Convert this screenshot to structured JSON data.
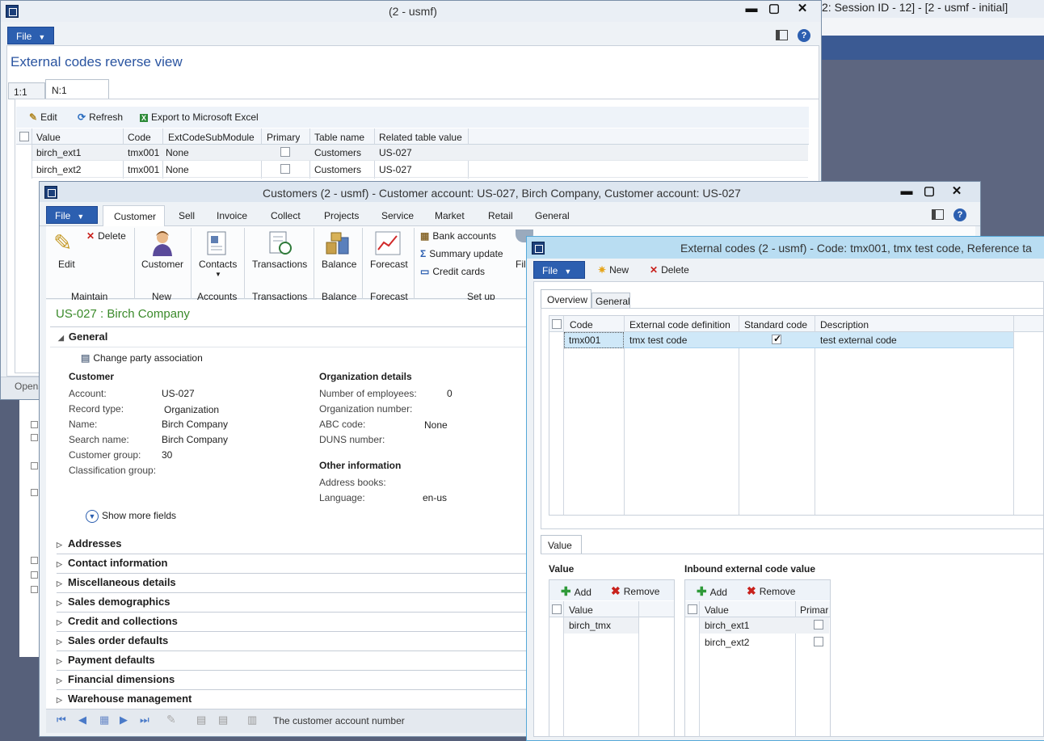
{
  "bg_window": {
    "title": "2: Session ID - 12] -  [2 - usmf - initial]"
  },
  "reverse_view": {
    "title": "(2 - usmf)",
    "file_label": "File",
    "heading": "External codes reverse view",
    "tabs": [
      "1:1",
      "N:1"
    ],
    "toolbar": {
      "edit": "Edit",
      "refresh": "Refresh",
      "export": "Export to Microsoft Excel"
    },
    "columns": [
      "Value",
      "Code",
      "ExtCodeSubModule",
      "Primary",
      "Table name",
      "Related table value"
    ],
    "rows": [
      {
        "value": "birch_ext1",
        "code": "tmx001",
        "submodule": "None",
        "table": "Customers",
        "related": "US-027"
      },
      {
        "value": "birch_ext2",
        "code": "tmx001",
        "submodule": "None",
        "table": "Customers",
        "related": "US-027"
      }
    ],
    "status": "Opens"
  },
  "customers": {
    "title": "Customers (2 - usmf) - Customer account: US-027, Birch Company, Customer account: US-027",
    "file_label": "File",
    "tabs": [
      "Customer",
      "Sell",
      "Invoice",
      "Collect",
      "Projects",
      "Service",
      "Market",
      "Retail",
      "General"
    ],
    "ribbon": {
      "edit": "Edit",
      "delete": "Delete",
      "maintain": "Maintain",
      "customer": "Customer",
      "new": "New",
      "contacts": "Contacts",
      "accounts": "Accounts",
      "transactions": "Transactions",
      "transactions_grp": "Transactions",
      "balance": "Balance",
      "balance_grp": "Balance",
      "forecast": "Forecast",
      "forecast_grp": "Forecast",
      "bank_accounts": "Bank accounts",
      "summary_update": "Summary update",
      "credit_cards": "Credit cards",
      "setup": "Set up",
      "filter_partial": "Fil"
    },
    "record_title": "US-027 : Birch Company",
    "general_label": "General",
    "change_party": "Change party association",
    "customer_section": "Customer",
    "org_section": "Organization details",
    "other_section": "Other information",
    "fields": {
      "account_lbl": "Account:",
      "account": "US-027",
      "record_type_lbl": "Record type:",
      "record_type": "Organization",
      "name_lbl": "Name:",
      "name": "Birch Company",
      "search_name_lbl": "Search name:",
      "search_name": "Birch Company",
      "cust_group_lbl": "Customer group:",
      "cust_group": "30",
      "class_group_lbl": "Classification group:",
      "employees_lbl": "Number of employees:",
      "employees": "0",
      "org_number_lbl": "Organization number:",
      "abc_lbl": "ABC code:",
      "abc": "None",
      "duns_lbl": "DUNS number:",
      "address_books_lbl": "Address books:",
      "language_lbl": "Language:",
      "language": "en-us"
    },
    "show_more": "Show more fields",
    "fasttabs": [
      "Addresses",
      "Contact information",
      "Miscellaneous details",
      "Sales demographics",
      "Credit and collections",
      "Sales order defaults",
      "Payment defaults",
      "Financial dimensions",
      "Warehouse management"
    ],
    "status_text": "The customer account number"
  },
  "ext_codes": {
    "title": "External codes (2 - usmf) - Code: tmx001, tmx test code, Reference ta",
    "file_label": "File",
    "new": "New",
    "delete": "Delete",
    "tabs": [
      "Overview",
      "General"
    ],
    "columns": [
      "Code",
      "External code definition",
      "Standard code",
      "Description"
    ],
    "rows": [
      {
        "code": "tmx001",
        "definition": "tmx test code",
        "standard": true,
        "description": "test external code"
      }
    ],
    "value_tab": "Value",
    "value_section": "Value",
    "inbound_section": "Inbound external code value",
    "add": "Add",
    "remove": "Remove",
    "value_col": "Value",
    "primary_col": "Primar",
    "values": [
      "birch_tmx"
    ],
    "inbound": [
      "birch_ext1",
      "birch_ext2"
    ]
  }
}
